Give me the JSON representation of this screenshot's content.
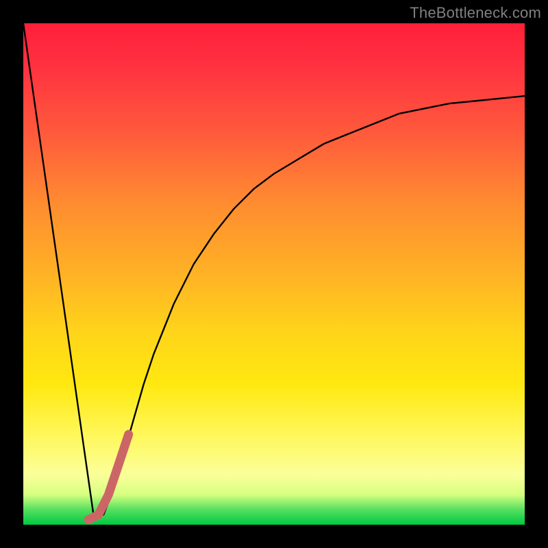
{
  "watermark": {
    "text": "TheBottleneck.com"
  },
  "colors": {
    "frame": "#000000",
    "curve_thin": "#000000",
    "curve_thick": "#cc6666",
    "gradient_stops": [
      "#ff1f3a",
      "#ff3040",
      "#ff5a3c",
      "#ff8c30",
      "#ffb225",
      "#ffd51a",
      "#ffe810",
      "#fff75a",
      "#fbff9a",
      "#d6ff80",
      "#55e060",
      "#00c840"
    ]
  },
  "chart_data": {
    "type": "line",
    "title": "",
    "xlabel": "",
    "ylabel": "",
    "xlim": [
      0,
      100
    ],
    "ylim": [
      0,
      100
    ],
    "grid": false,
    "legend": false,
    "description": "Bottleneck-percentage curve: steep linear descent from top-left to a minimum near x≈14, then asymptotic rise toward ~85 at right edge. A short thick pink segment overlays the rising branch near the minimum.",
    "series": [
      {
        "name": "bottleneck_curve",
        "x": [
          0,
          2,
          4,
          6,
          8,
          10,
          12,
          14,
          16,
          18,
          20,
          22,
          24,
          26,
          28,
          30,
          34,
          38,
          42,
          46,
          50,
          55,
          60,
          65,
          70,
          75,
          80,
          85,
          90,
          95,
          100
        ],
        "y": [
          100,
          86,
          72,
          58,
          44,
          30,
          16,
          2,
          2,
          7,
          14,
          21,
          28,
          34,
          39,
          44,
          52,
          58,
          63,
          67,
          70,
          73,
          76,
          78,
          80,
          82,
          83,
          84,
          84.5,
          85,
          85.5
        ]
      },
      {
        "name": "highlight_segment",
        "x": [
          13,
          15,
          17,
          19,
          21
        ],
        "y": [
          1,
          2,
          6,
          12,
          18
        ]
      }
    ]
  }
}
